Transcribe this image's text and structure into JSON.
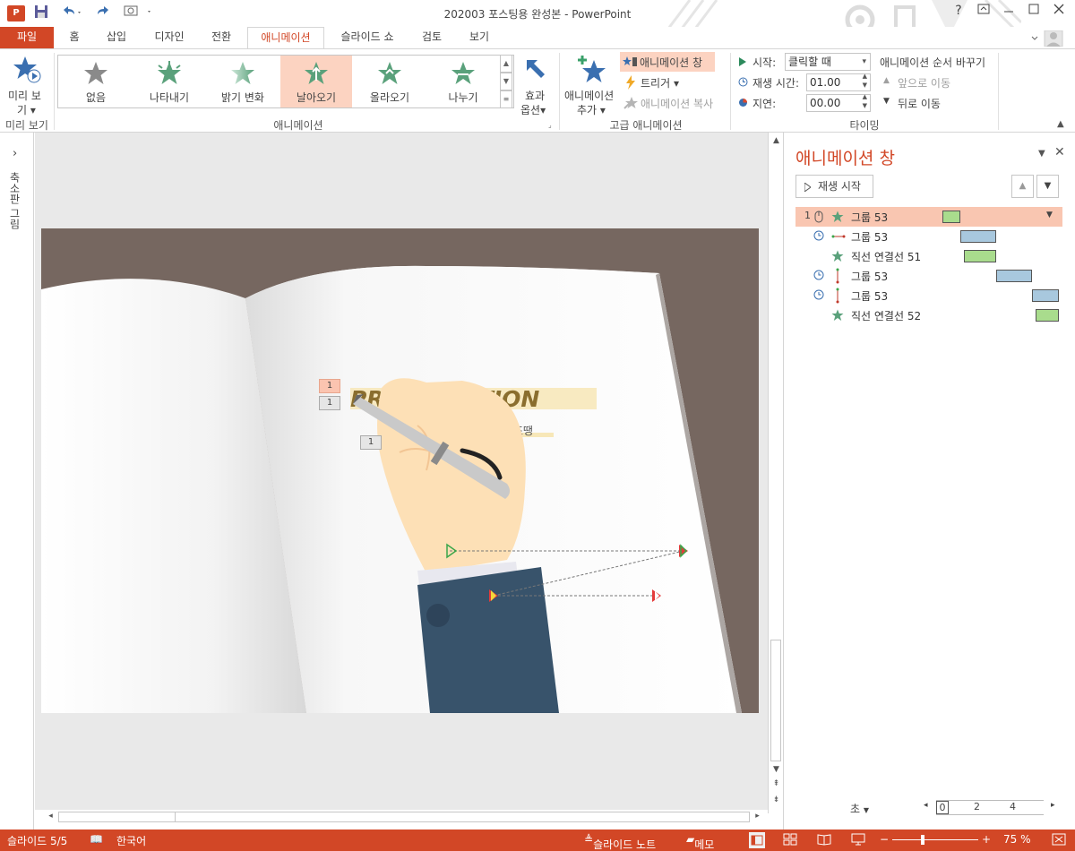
{
  "window": {
    "title": "202003 포스팅용 완성본 - PowerPoint",
    "help": "?",
    "app_icon": "P"
  },
  "tabs": [
    {
      "label": "파일"
    },
    {
      "label": "홈"
    },
    {
      "label": "삽입"
    },
    {
      "label": "디자인"
    },
    {
      "label": "전환"
    },
    {
      "label": "애니메이션"
    },
    {
      "label": "슬라이드 쇼"
    },
    {
      "label": "검토"
    },
    {
      "label": "보기"
    }
  ],
  "ribbon": {
    "preview": {
      "label_line1": "미리 보",
      "label_line2": "기",
      "group": "미리 보기"
    },
    "gallery": {
      "items": [
        {
          "label": "없음",
          "color": "#8a8a8a"
        },
        {
          "label": "나타내기",
          "color": "#5aa17b"
        },
        {
          "label": "밝기 변화",
          "color": "#8fc7a7"
        },
        {
          "label": "날아오기",
          "color": "#5aa17b"
        },
        {
          "label": "올라오기",
          "color": "#5aa17b"
        },
        {
          "label": "나누기",
          "color": "#5aa17b"
        }
      ],
      "selected_index": 3,
      "group": "애니메이션"
    },
    "effect_options": {
      "line1": "효과",
      "line2": "옵션"
    },
    "add_animation": {
      "line1": "애니메이션",
      "line2": "추가"
    },
    "advanced": {
      "pane": "애니메이션 창",
      "trigger": "트리거",
      "painter": "애니메이션 복사",
      "group": "고급 애니메이션"
    },
    "timing": {
      "start_label": "시작:",
      "start_value": "클릭할 때",
      "duration_label": "재생 시간:",
      "duration_value": "01.00",
      "delay_label": "지연:",
      "delay_value": "00.00",
      "reorder_title": "애니메이션 순서 바꾸기",
      "move_earlier": "앞으로 이동",
      "move_later": "뒤로 이동",
      "group": "타이밍"
    }
  },
  "left_pane": {
    "label": "축소판 그림"
  },
  "slide": {
    "title_text": "PRESENTATION",
    "subtitle_text": "한 조땡",
    "tags": [
      "1",
      "1",
      "1"
    ]
  },
  "animation_pane": {
    "title": "애니메이션 창",
    "play_button": "재생 시작",
    "items": [
      {
        "num": "1",
        "name": "그룹 53",
        "type": "entrance",
        "selected": true
      },
      {
        "num": "",
        "name": "그룹 53",
        "type": "path-h",
        "selected": false
      },
      {
        "num": "",
        "name": "직선 연결선 51",
        "type": "entrance",
        "selected": false
      },
      {
        "num": "",
        "name": "그룹 53",
        "type": "path-v",
        "selected": false
      },
      {
        "num": "",
        "name": "그룹 53",
        "type": "path-v",
        "selected": false
      },
      {
        "num": "",
        "name": "직선 연결선 52",
        "type": "entrance",
        "selected": false
      }
    ],
    "seconds_label": "초",
    "timeline_ticks": [
      "0",
      "2",
      "4"
    ]
  },
  "status_bar": {
    "slide_info": "슬라이드 5/5",
    "language": "한국어",
    "notes": "슬라이드 노트",
    "comments": "메모",
    "zoom": "75 %"
  },
  "colors": {
    "accent": "#d24726",
    "selection": "#f9c6b1",
    "bar_green": "#a9dc8d",
    "bar_blue": "#a8c8de"
  }
}
